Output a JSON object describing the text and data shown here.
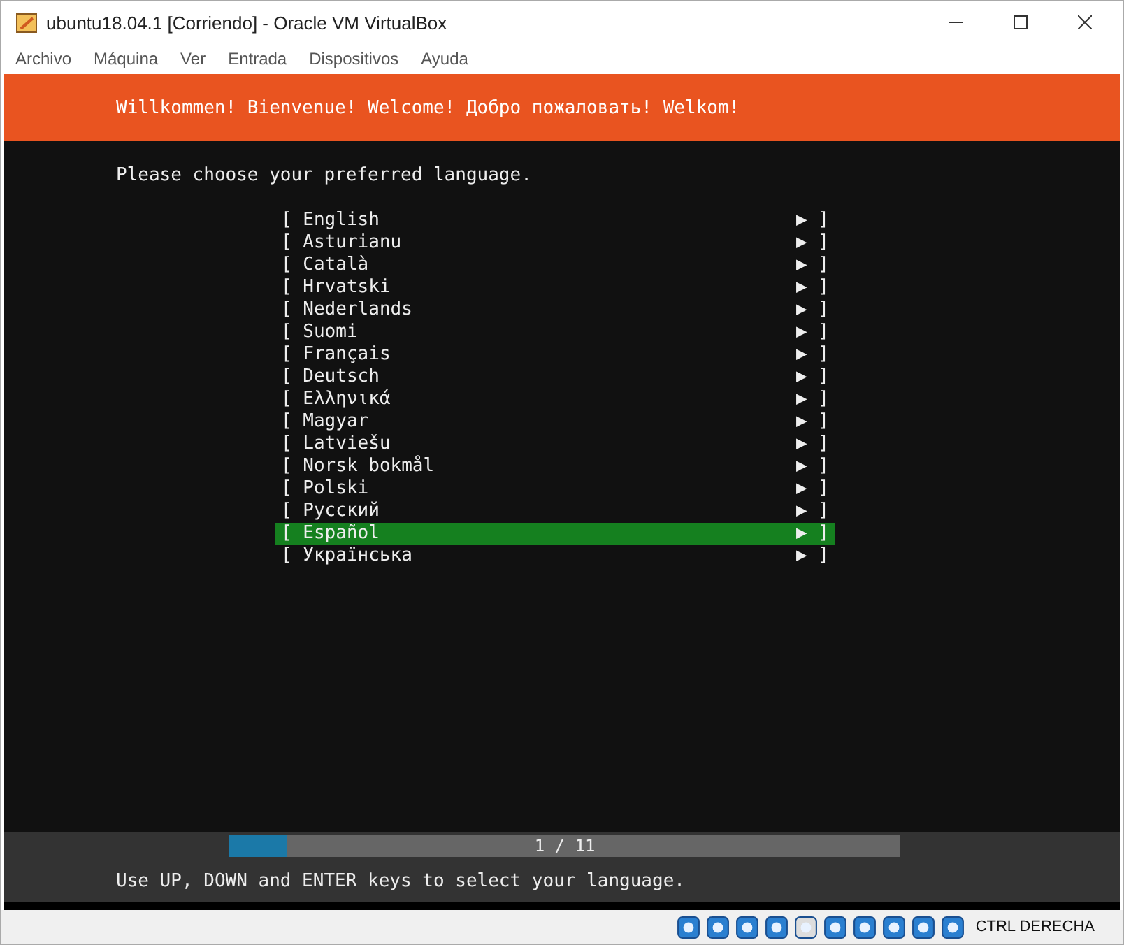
{
  "window": {
    "title": "ubuntu18.04.1 [Corriendo] - Oracle VM VirtualBox"
  },
  "menu": [
    "Archivo",
    "Máquina",
    "Ver",
    "Entrada",
    "Dispositivos",
    "Ayuda"
  ],
  "banner": "Willkommen! Bienvenue! Welcome! Добро пожаловать! Welkom!",
  "prompt": "Please choose your preferred language.",
  "languages": [
    {
      "open": "[",
      "label": "English",
      "arrow": "▶",
      "close": "]",
      "selected": false
    },
    {
      "open": "[",
      "label": "Asturianu",
      "arrow": "▶",
      "close": "]",
      "selected": false
    },
    {
      "open": "[",
      "label": "Català",
      "arrow": "▶",
      "close": "]",
      "selected": false
    },
    {
      "open": "[",
      "label": "Hrvatski",
      "arrow": "▶",
      "close": "]",
      "selected": false
    },
    {
      "open": "[",
      "label": "Nederlands",
      "arrow": "▶",
      "close": "]",
      "selected": false
    },
    {
      "open": "[",
      "label": "Suomi",
      "arrow": "▶",
      "close": "]",
      "selected": false
    },
    {
      "open": "[",
      "label": "Français",
      "arrow": "▶",
      "close": "]",
      "selected": false
    },
    {
      "open": "[",
      "label": "Deutsch",
      "arrow": "▶",
      "close": "]",
      "selected": false
    },
    {
      "open": "[",
      "label": "Ελληνικά",
      "arrow": "▶",
      "close": "]",
      "selected": false
    },
    {
      "open": "[",
      "label": "Magyar",
      "arrow": "▶",
      "close": "]",
      "selected": false
    },
    {
      "open": "[",
      "label": "Latviešu",
      "arrow": "▶",
      "close": "]",
      "selected": false
    },
    {
      "open": "[",
      "label": "Norsk bokmål",
      "arrow": "▶",
      "close": "]",
      "selected": false
    },
    {
      "open": "[",
      "label": "Polski",
      "arrow": "▶",
      "close": "]",
      "selected": false
    },
    {
      "open": "[",
      "label": "Русский",
      "arrow": "▶",
      "close": "]",
      "selected": false
    },
    {
      "open": "[",
      "label": "Español",
      "arrow": "▶",
      "close": "]",
      "selected": true
    },
    {
      "open": "[",
      "label": "Українська",
      "arrow": "▶",
      "close": "]",
      "selected": false
    }
  ],
  "progress": {
    "level": 0.085,
    "label": "1 / 11"
  },
  "hint": "Use UP, DOWN and ENTER keys to select your language.",
  "status_bar": {
    "host_key": "CTRL DERECHA"
  }
}
